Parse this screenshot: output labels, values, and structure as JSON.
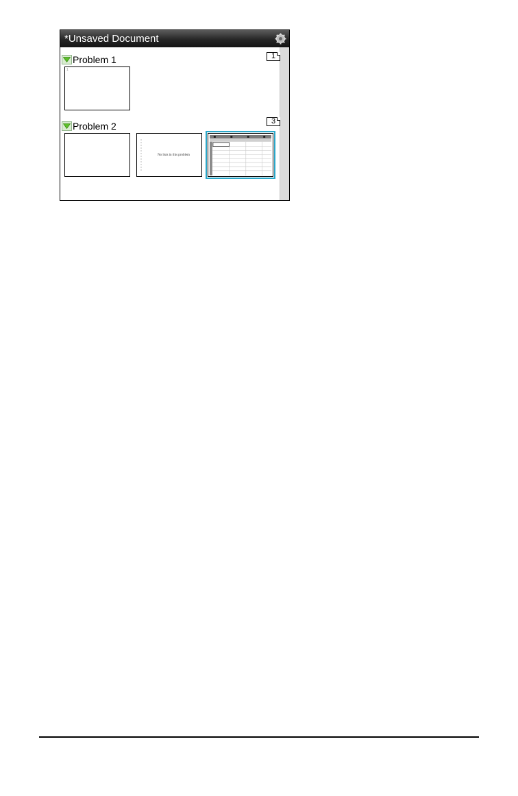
{
  "window": {
    "title": "*Unsaved Document"
  },
  "icons": {
    "settings": "gear-icon",
    "collapse": "triangle-down-icon"
  },
  "colors": {
    "titlebar": "#262626",
    "selection": "#2aa7c9",
    "expand_icon": "#5cbf2a"
  },
  "problems": [
    {
      "label": "Problem 1",
      "page_count": "1",
      "pages": [
        {
          "kind": "blank",
          "page_number": "1"
        }
      ]
    },
    {
      "label": "Problem 2",
      "page_count": "3",
      "pages": [
        {
          "kind": "blank"
        },
        {
          "kind": "data-plot",
          "message": "No lists in this problem"
        },
        {
          "kind": "spreadsheet",
          "selected": true
        }
      ]
    }
  ]
}
